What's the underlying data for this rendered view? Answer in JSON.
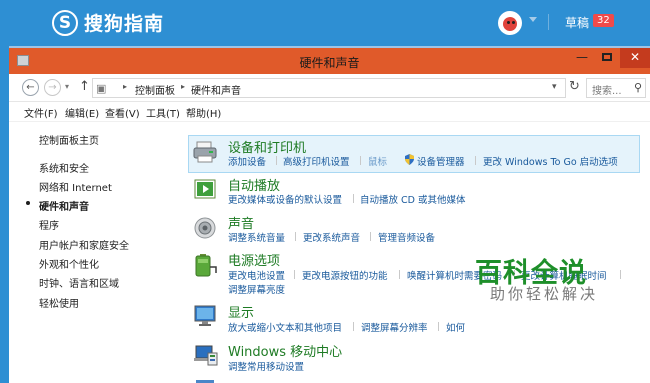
{
  "header": {
    "site_name": "搜狗指南",
    "draft_label": "草稿",
    "draft_count": "32"
  },
  "window": {
    "title": "硬件和声音"
  },
  "address": {
    "breadcrumb": [
      "控制面板",
      "硬件和声音"
    ],
    "search_placeholder": "搜索..."
  },
  "menu": [
    "文件(F)",
    "编辑(E)",
    "查看(V)",
    "工具(T)",
    "帮助(H)"
  ],
  "left_nav": [
    "控制面板主页",
    "系统和安全",
    "网络和 Internet",
    "硬件和声音",
    "程序",
    "用户帐户和家庭安全",
    "外观和个性化",
    "时钟、语言和区域",
    "轻松使用"
  ],
  "categories": [
    {
      "title": "设备和打印机",
      "links": [
        "添加设备",
        "高级打印机设置",
        "鼠标",
        "设备管理器",
        "更改 Windows To Go 启动选项"
      ]
    },
    {
      "title": "自动播放",
      "links": [
        "更改媒体或设备的默认设置",
        "自动播放 CD 或其他媒体"
      ]
    },
    {
      "title": "声音",
      "links": [
        "调整系统音量",
        "更改系统声音",
        "管理音频设备"
      ]
    },
    {
      "title": "电源选项",
      "links": [
        "更改电池设置",
        "更改电源按钮的功能",
        "唤醒计算机时需要密码",
        "更改计算机睡眠时间",
        "调整屏幕亮度"
      ]
    },
    {
      "title": "显示",
      "links": [
        "放大或缩小文本和其他项目",
        "调整屏幕分辨率",
        "如何"
      ]
    },
    {
      "title": "Windows 移动中心",
      "links": [
        "调整常用移动设置"
      ]
    }
  ],
  "watermark": {
    "title": "百科全说",
    "subtitle": "助你轻松解决"
  },
  "colors": {
    "accent": "#2e8fd3",
    "titlebar": "#e05a2a",
    "link": "#1a5a9c",
    "category_title": "#1e7b24"
  }
}
